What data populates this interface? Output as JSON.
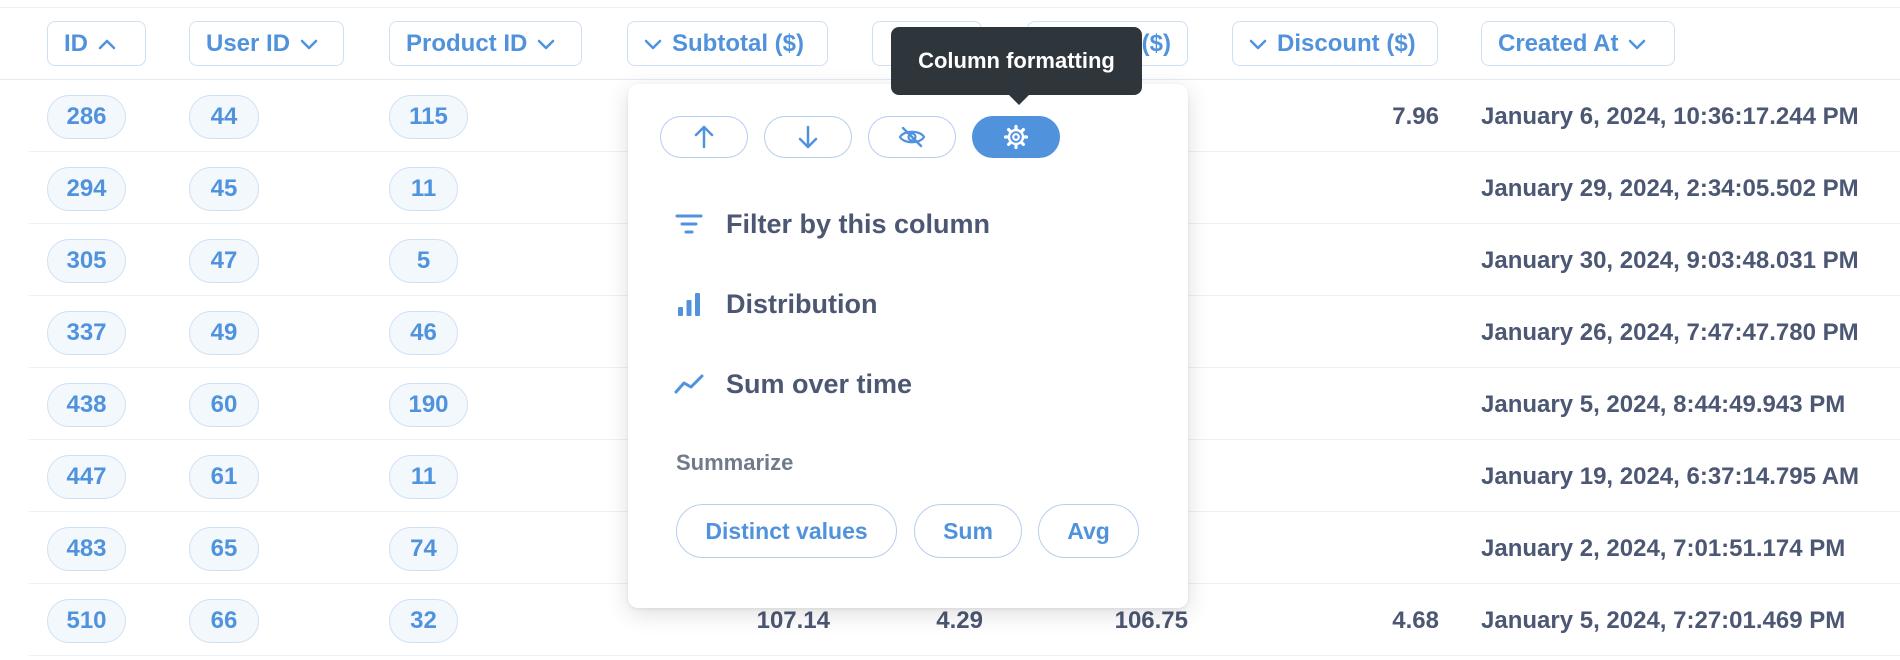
{
  "columns": [
    {
      "id": "id",
      "label": "ID",
      "sort": "asc"
    },
    {
      "id": "user_id",
      "label": "User ID"
    },
    {
      "id": "product_id",
      "label": "Product ID"
    },
    {
      "id": "subtotal",
      "label": "Subtotal ($)"
    },
    {
      "id": "tax",
      "label": ""
    },
    {
      "id": "total",
      "label": "($)"
    },
    {
      "id": "discount",
      "label": "Discount ($)"
    },
    {
      "id": "created_at",
      "label": "Created At"
    }
  ],
  "rows": [
    {
      "id": "286",
      "user_id": "44",
      "product_id": "115",
      "subtotal": "",
      "tax": "",
      "total": "",
      "discount": "7.96",
      "created_at": "January 6, 2024, 10:36:17.244 PM"
    },
    {
      "id": "294",
      "user_id": "45",
      "product_id": "11",
      "subtotal": "",
      "tax": "",
      "total": "",
      "discount": "",
      "created_at": "January 29, 2024, 2:34:05.502 PM"
    },
    {
      "id": "305",
      "user_id": "47",
      "product_id": "5",
      "subtotal": "",
      "tax": "",
      "total": "",
      "discount": "",
      "created_at": "January 30, 2024, 9:03:48.031 PM"
    },
    {
      "id": "337",
      "user_id": "49",
      "product_id": "46",
      "subtotal": "",
      "tax": "",
      "total": "",
      "discount": "",
      "created_at": "January 26, 2024, 7:47:47.780 PM"
    },
    {
      "id": "438",
      "user_id": "60",
      "product_id": "190",
      "subtotal": "",
      "tax": "",
      "total": "",
      "discount": "",
      "created_at": "January 5, 2024, 8:44:49.943 PM"
    },
    {
      "id": "447",
      "user_id": "61",
      "product_id": "11",
      "subtotal": "",
      "tax": "",
      "total": "",
      "discount": "",
      "created_at": "January 19, 2024, 6:37:14.795 AM"
    },
    {
      "id": "483",
      "user_id": "65",
      "product_id": "74",
      "subtotal": "",
      "tax": "",
      "total": "",
      "discount": "",
      "created_at": "January 2, 2024, 7:01:51.174 PM"
    },
    {
      "id": "510",
      "user_id": "66",
      "product_id": "32",
      "subtotal": "107.14",
      "tax": "4.29",
      "total": "106.75",
      "discount": "4.68",
      "created_at": "January 5, 2024, 7:27:01.469 PM"
    }
  ],
  "popover": {
    "actions": [
      {
        "name": "sort-ascending",
        "icon": "arrow-up-icon"
      },
      {
        "name": "sort-descending",
        "icon": "arrow-down-icon"
      },
      {
        "name": "hide-column",
        "icon": "eye-off-icon"
      },
      {
        "name": "column-formatting",
        "icon": "gear-icon",
        "active": true
      }
    ],
    "menu": [
      {
        "label": "Filter by this column",
        "icon": "filter-icon"
      },
      {
        "label": "Distribution",
        "icon": "bar-chart-icon"
      },
      {
        "label": "Sum over time",
        "icon": "line-chart-icon"
      }
    ],
    "summarize_label": "Summarize",
    "summarize_options": [
      "Distinct values",
      "Sum",
      "Avg"
    ]
  },
  "tooltip": {
    "text": "Column formatting"
  },
  "colors": {
    "brand": "#5093dc",
    "text": "#4c5773",
    "tooltip_bg": "#2e353b"
  }
}
